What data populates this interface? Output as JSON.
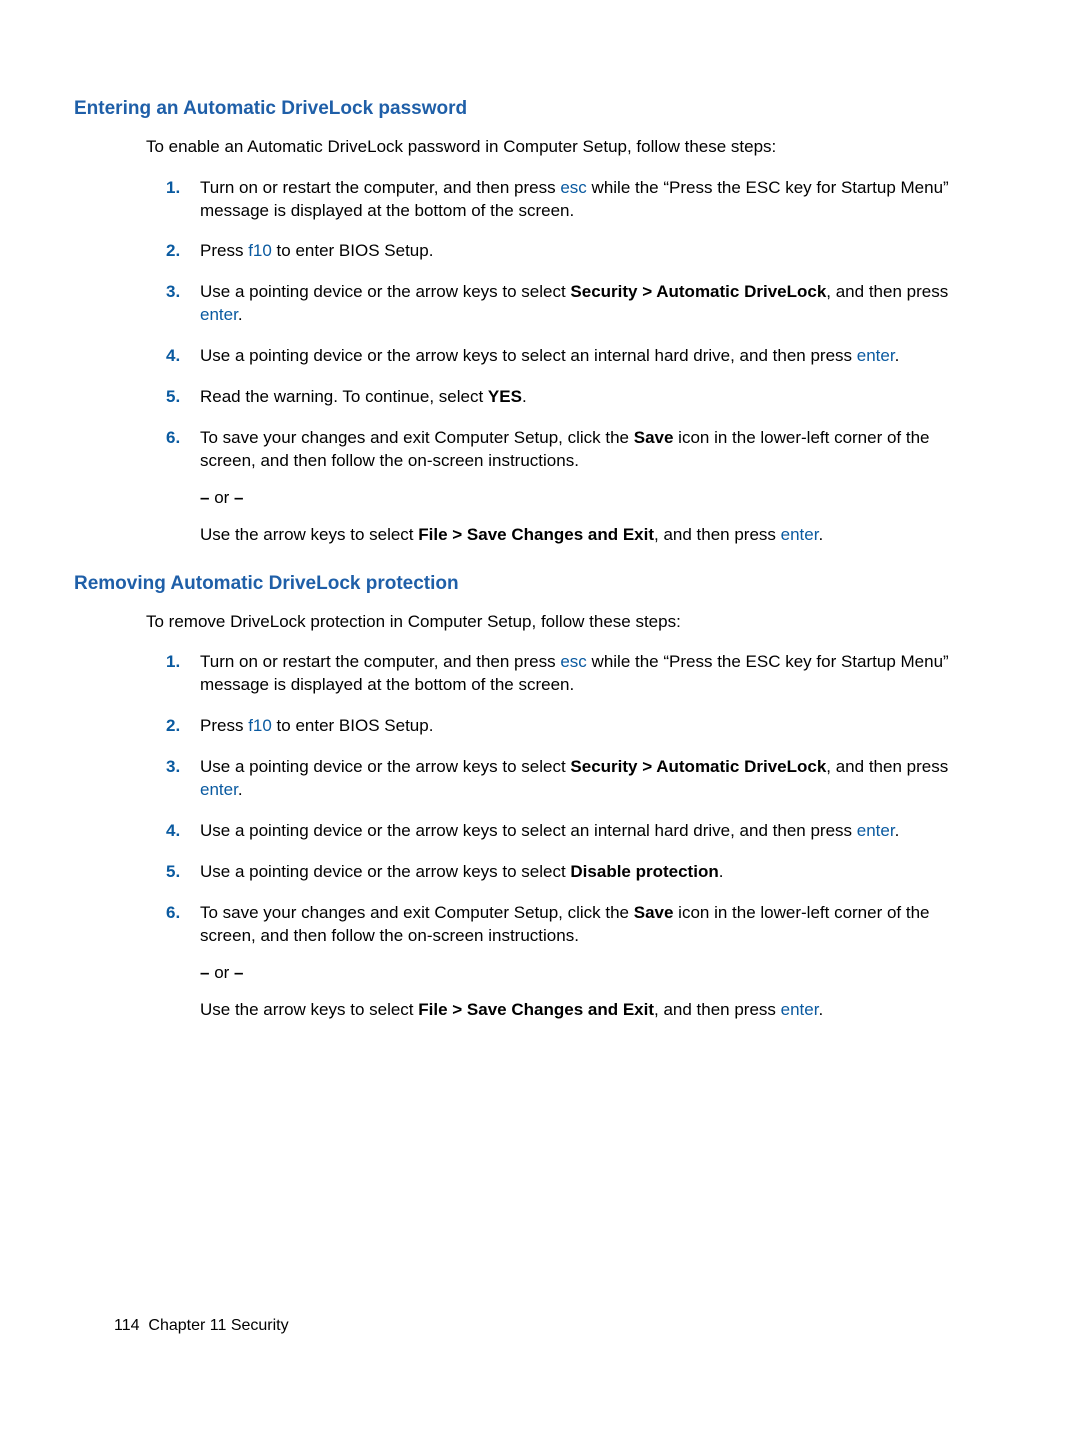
{
  "section1": {
    "heading": "Entering an Automatic DriveLock password",
    "intro": "To enable an Automatic DriveLock password in Computer Setup, follow these steps:",
    "steps": [
      {
        "num": "1.",
        "parts": [
          "Turn on or restart the computer, and then press ",
          {
            "k": "esc"
          },
          " while the “Press the ESC key for Startup Menu” message is displayed at the bottom of the screen."
        ]
      },
      {
        "num": "2.",
        "parts": [
          "Press ",
          {
            "k": "f10"
          },
          " to enter BIOS Setup."
        ]
      },
      {
        "num": "3.",
        "parts": [
          "Use a pointing device or the arrow keys to select ",
          {
            "b": "Security > Automatic DriveLock"
          },
          ", and then press ",
          {
            "k": "enter"
          },
          "."
        ]
      },
      {
        "num": "4.",
        "parts": [
          "Use a pointing device or the arrow keys to select an internal hard drive, and then press ",
          {
            "k": "enter"
          },
          "."
        ]
      },
      {
        "num": "5.",
        "parts": [
          "Read the warning. To continue, select ",
          {
            "b": "YES"
          },
          "."
        ]
      },
      {
        "num": "6.",
        "multi": [
          {
            "parts": [
              "To save your changes and exit Computer Setup, click the ",
              {
                "b": "Save"
              },
              " icon in the lower-left corner of the screen, and then follow the on-screen instructions."
            ]
          },
          {
            "parts": [
              {
                "b": "–"
              },
              " or ",
              {
                "b": "–"
              }
            ]
          },
          {
            "parts": [
              "Use the arrow keys to select ",
              {
                "b": "File > Save Changes and Exit"
              },
              ", and then press ",
              {
                "k": "enter"
              },
              "."
            ]
          }
        ]
      }
    ]
  },
  "section2": {
    "heading": "Removing Automatic DriveLock protection",
    "intro": "To remove DriveLock protection in Computer Setup, follow these steps:",
    "steps": [
      {
        "num": "1.",
        "parts": [
          "Turn on or restart the computer, and then press ",
          {
            "k": "esc"
          },
          " while the “Press the ESC key for Startup Menu” message is displayed at the bottom of the screen."
        ]
      },
      {
        "num": "2.",
        "parts": [
          "Press ",
          {
            "k": "f10"
          },
          " to enter BIOS Setup."
        ]
      },
      {
        "num": "3.",
        "parts": [
          "Use a pointing device or the arrow keys to select ",
          {
            "b": "Security > Automatic DriveLock"
          },
          ", and then press ",
          {
            "k": "enter"
          },
          "."
        ]
      },
      {
        "num": "4.",
        "parts": [
          "Use a pointing device or the arrow keys to select an internal hard drive, and then press ",
          {
            "k": "enter"
          },
          "."
        ]
      },
      {
        "num": "5.",
        "parts": [
          "Use a pointing device or the arrow keys to select ",
          {
            "b": "Disable protection"
          },
          "."
        ]
      },
      {
        "num": "6.",
        "multi": [
          {
            "parts": [
              "To save your changes and exit Computer Setup, click the ",
              {
                "b": "Save"
              },
              " icon in the lower-left corner of the screen, and then follow the on-screen instructions."
            ]
          },
          {
            "parts": [
              {
                "b": "–"
              },
              " or ",
              {
                "b": "–"
              }
            ]
          },
          {
            "parts": [
              "Use the arrow keys to select ",
              {
                "b": "File > Save Changes and Exit"
              },
              ", and then press ",
              {
                "k": "enter"
              },
              "."
            ]
          }
        ]
      }
    ]
  },
  "footer": {
    "page": "114",
    "chapter": "Chapter 11   Security"
  }
}
